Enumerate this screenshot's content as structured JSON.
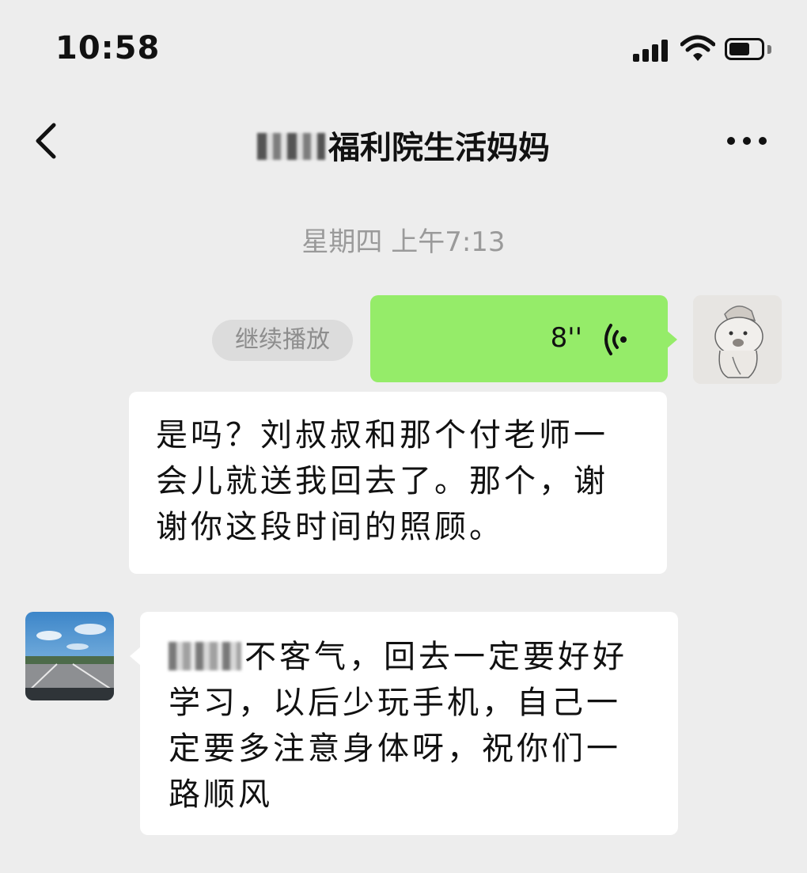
{
  "status_bar": {
    "time": "10:58",
    "battery_level": 0.65
  },
  "header": {
    "title": "福利院生活妈妈"
  },
  "chat": {
    "timestamp": "星期四 上午7:13",
    "continue_label": "继续播放",
    "voice_duration": "8''",
    "message_outgoing": "是吗？刘叔叔和那个付老师一会儿就送我回去了。那个，谢谢你这段时间的照顾。",
    "message_incoming": "不客气，回去一定要好好学习，以后少玩手机，自己一定要多注意身体呀，祝你们一路顺风"
  },
  "colors": {
    "background": "#ededed",
    "outgoing_bubble": "#95ec69",
    "incoming_bubble": "#ffffff",
    "timestamp": "#9a9a9a"
  }
}
